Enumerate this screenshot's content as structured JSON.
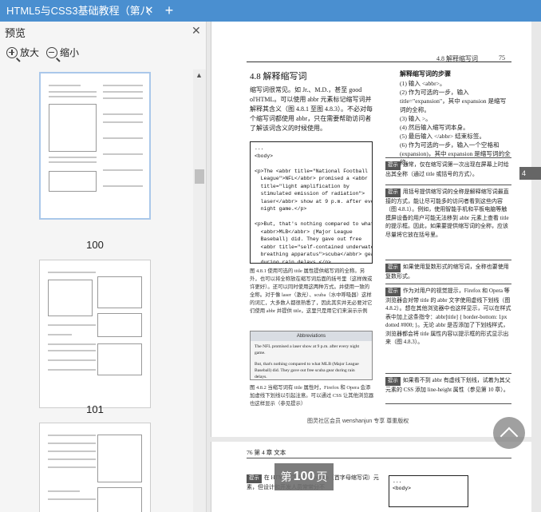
{
  "tab": {
    "title": "HTML5与CSS3基础教程（第八",
    "close": "✕",
    "add": "+"
  },
  "panel": {
    "title": "预览",
    "close": "✕",
    "zoom_in": "放大",
    "zoom_out": "缩小"
  },
  "thumbnails": [
    {
      "label": "100",
      "selected": true
    },
    {
      "label": "101",
      "selected": false
    },
    {
      "label": "",
      "selected": false
    }
  ],
  "page": {
    "header_chapter": "4.8 解释缩写词",
    "header_num": "75",
    "section_title": "4.8  解释缩写词",
    "intro": "缩写词很常见。如 Jr.、M.D.，甚至 good ol'HTML。可以使用 abbr 元素标记缩写词并解释其含义（图 4.8.1 至图 4.8.3）。不必对每个缩写词都使用 abbr，只在需要帮助访问者了解该词含义的时候使用。",
    "code": "...\n<body>\n\n<p>The <abbr title=\"National Football\n  League\">NFL</abbr> promised a <abbr\n  title=\"light amplification by\n  stimulated emission of radiation\">\n  laser</abbr> show at 9 p.m. after every\n  night game.</p>\n\n<p>But, that's nothing compared to what\n  <abbr>MLB</abbr> (Major League\n  Baseball) did. They gave out free\n  <abbr title=\"self-contained underwater\n  breathing apparatus\">scuba</abbr> gear\n  during rain delays.</p>\n\n</body>\n</html>",
    "fig1_caption": "图 4.8.1  使用可选的 title 属性提供缩写词的全称。另外，也可以将全称放在缩写词后面的括号里（这样做或许更好）。还可以同时使用这两种方式。并使用一致的全称。对于像 laser（激光）、scuba（水中呼吸器）这样的词汇，大多数人都很熟悉了，因此其实并无必要对它们使用 abbr 并提供 title，这里只是用它们来演示示例",
    "shot_title": "Abbreviations",
    "shot_text1": "The NFL promised a laser show at 9 p.m. after every night game.",
    "shot_text2": "But, that's nothing compared to what MLB (Major League Baseball) did. They gave out free scuba gear during rain delays.",
    "fig2_caption": "图 4.8.2  当缩写词有 title 属性时，Firefox 和 Opera 会添加虚线下划线以引起注意。可以通过 CSS 让其他浏览器也这样显示（参见提示）",
    "steps_title": "解释缩写词的步骤",
    "steps": [
      "(1) 输入 <abbr>。",
      "(2) 作为可选的一步，输入 title=\"expansion\"，其中 expansion 是缩写词的全称。",
      "(3) 输入 >。",
      "(4) 然后输入缩写词本身。",
      "(5) 最后输入 </abbr> 结束标签。",
      "(6) 作为可选的一步，输入一个空格和 (expansion)，其中 expansion 是缩写词的全称。"
    ],
    "tip_label": "提示",
    "tips": [
      "通常，仅在缩写词第一次出现在屏幕上时给出其全称（通过 title 或括号的方式）。",
      "用括号提供缩写词的全称是解释缩写词最直接的方式，能让尽可能多的访问者看到这些内容（图 4.8.1）。例如，使用智能手机和平板电脑等触摸屏设备的用户可能无法移到 abbr 元素上查看 title 的提示框。因此，如果要提供缩写词的全称，应该尽量将它放在括号里。",
      "如果使用复数形式的缩写词，全称也要使用复数形式。",
      "作为对用户的视觉提示，Firefox 和 Opera 等浏览器会对带 title 的 abbr 文字使用虚线下划线（图 4.8.2）。想在其他浏览器中也这样显示，可以在样式表中加上这条指令：abbr[title] { border-bottom: 1px dotted #000; }。无论 abbr 是否添加了下划线样式，浏览器都会将 title 属性内容以提示框的形式显示出来（图 4.8.3）。",
      "如果看不到 abbr 有虚线下划线，试着为其父元素的 CSS 添加 line-height 属性（参见第 10 章）。"
    ],
    "side_tab": "4",
    "footer_note": "图灵社区会员 wenshanjun 专享 尊重版权"
  },
  "page2": {
    "header": "76    第 4 章  文本",
    "tip": "在 HTML5 之前有 acronym（首字母缩写词）元素，但设计和开发人员常常分不",
    "code": "...\n<body>"
  },
  "page_indicator": {
    "prefix": "第",
    "number": "100",
    "suffix": "页"
  }
}
